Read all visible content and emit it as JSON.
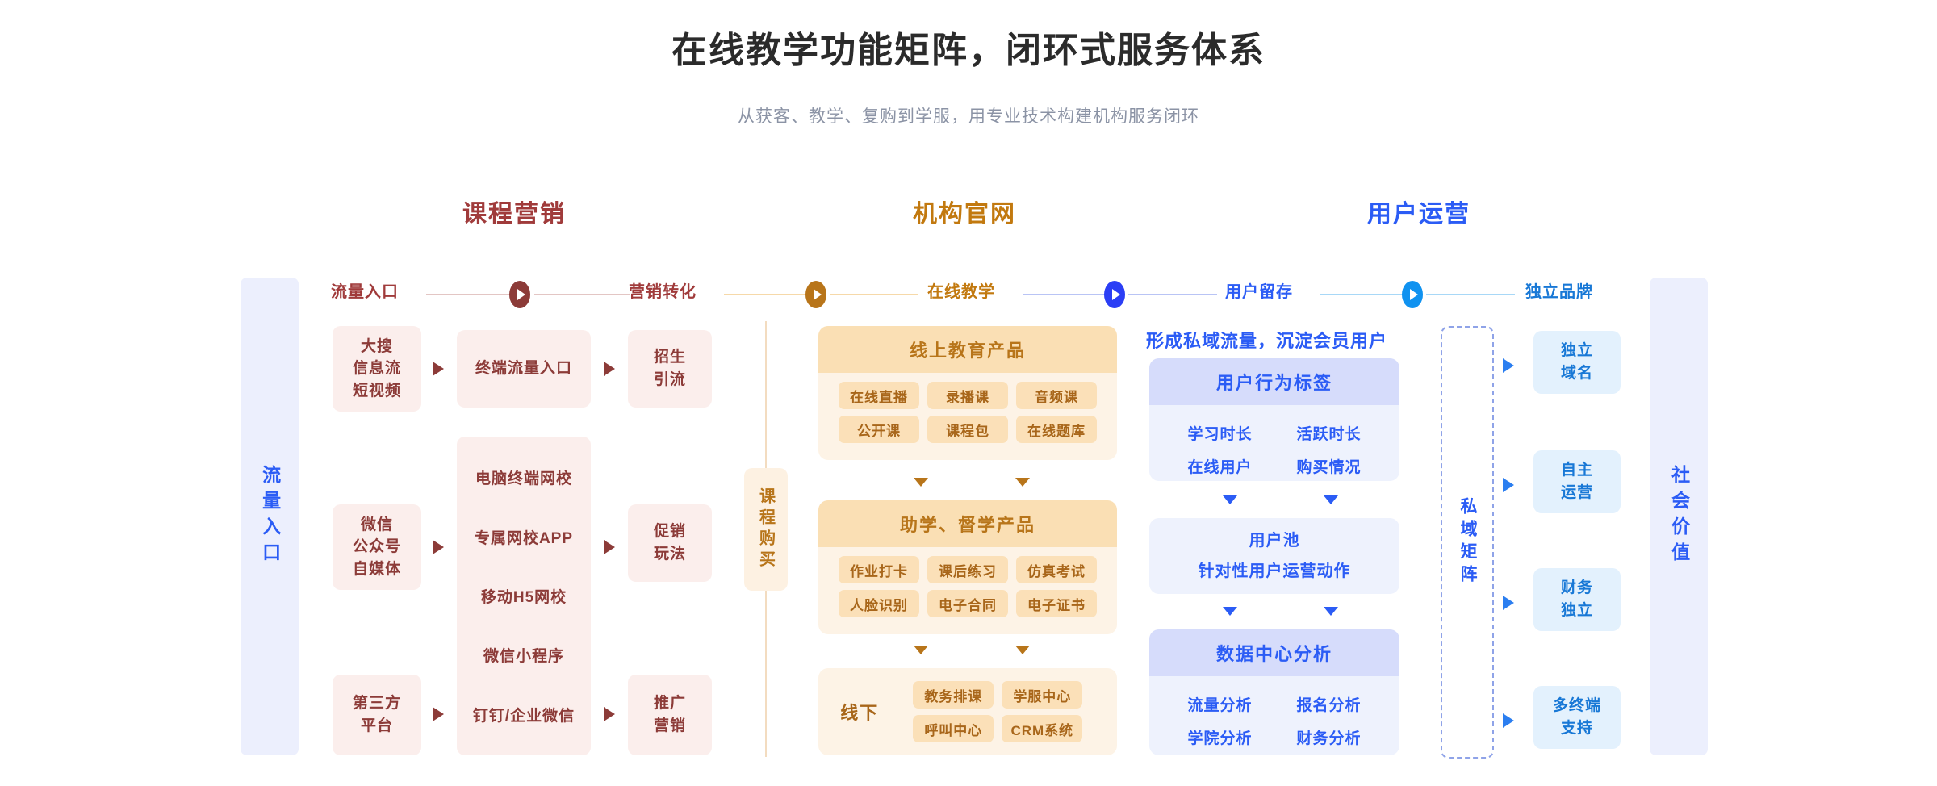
{
  "header": {
    "title": "在线教学功能矩阵，闭环式服务体系",
    "subtitle": "从获客、教学、复购到学服，用专业技术构建机构服务闭环"
  },
  "sections": [
    {
      "label": "课程营销",
      "color": "#a03b3b"
    },
    {
      "label": "机构官网",
      "color": "#c2790f"
    },
    {
      "label": "用户运营",
      "color": "#2b5cf5"
    }
  ],
  "stages": [
    {
      "label": "流量入口",
      "color": "#a03b3b"
    },
    {
      "label": "营销转化",
      "color": "#b8751a"
    },
    {
      "label": "在线教学",
      "color": "#c2790f"
    },
    {
      "label": "用户留存",
      "color": "#2b5cf5"
    },
    {
      "label": "独立品牌",
      "color": "#1878d6"
    }
  ],
  "connectors": [
    {
      "node_color": "#8c3b38",
      "line_color": "#e3c6c4"
    },
    {
      "node_color": "#b8751a",
      "line_color": "#f6d9a9"
    },
    {
      "node_color": "#2b3ef5",
      "line_color": "#b9c4f5"
    },
    {
      "node_color": "#1092f0",
      "line_color": "#a8d8f7"
    }
  ],
  "left_rail": {
    "label": "流量入口"
  },
  "right_rail": {
    "label": "社会价值"
  },
  "traffic_sources": [
    {
      "lines": [
        "大搜",
        "信息流",
        "短视频"
      ]
    },
    {
      "lines": [
        "微信",
        "公众号",
        "自媒体"
      ]
    },
    {
      "lines": [
        "第三方",
        "平台"
      ]
    }
  ],
  "terminals": {
    "top": {
      "lines": [
        "终端流量入口"
      ]
    },
    "list": [
      "电脑终端网校",
      "专属网校APP",
      "移动H5网校",
      "微信小程序",
      "钉钉/企业微信"
    ]
  },
  "conversions": [
    {
      "lines": [
        "招生",
        "引流"
      ]
    },
    {
      "lines": [
        "促销",
        "玩法"
      ]
    },
    {
      "lines": [
        "推广",
        "营销"
      ]
    }
  ],
  "course_purchase": {
    "label": "课程购买"
  },
  "teaching_panels": [
    {
      "head": "线上教育产品",
      "tags": [
        "在线直播",
        "录播课",
        "音频课",
        "公开课",
        "课程包",
        "在线题库"
      ]
    },
    {
      "head": "助学、督学产品",
      "tags": [
        "作业打卡",
        "课后练习",
        "仿真考试",
        "人脸识别",
        "电子合同",
        "电子证书"
      ]
    }
  ],
  "offline_panel": {
    "label": "线下",
    "tags": [
      "教务排课",
      "学服中心",
      "呼叫中心",
      "CRM系统"
    ]
  },
  "operation": {
    "title": "形成私域流量，沉淀会员用户",
    "tag_panel": {
      "head": "用户行为标签",
      "items": [
        "学习时长",
        "活跃时长",
        "在线用户",
        "购买情况"
      ]
    },
    "pool_panel": {
      "line1": "用户池",
      "line2": "针对性用户运营动作"
    },
    "data_panel": {
      "head": "数据中心分析",
      "items": [
        "流量分析",
        "报名分析",
        "学院分析",
        "财务分析"
      ]
    }
  },
  "private_matrix": {
    "label": "私域矩阵"
  },
  "brand_cards": [
    {
      "lines": [
        "独立",
        "域名"
      ]
    },
    {
      "lines": [
        "自主",
        "运营"
      ]
    },
    {
      "lines": [
        "财务",
        "独立"
      ]
    },
    {
      "lines": [
        "多终端",
        "支持"
      ]
    }
  ]
}
